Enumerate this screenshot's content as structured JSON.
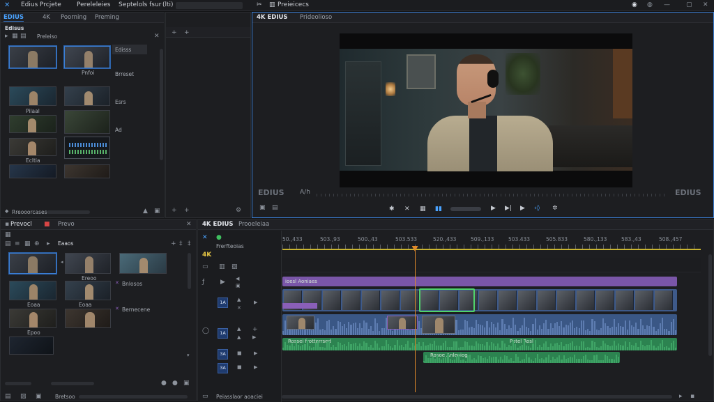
{
  "menubar": {
    "items": [
      "Edius",
      "Prcjete",
      "Pereleleies",
      "Septelols fsur",
      "(lti)"
    ],
    "preview_title": "Preieicecs"
  },
  "bin": {
    "tabs": [
      "EDIUS",
      "4K",
      "Poorning",
      "Preming"
    ],
    "folder_label": "Edisus",
    "sub_tab": "Preleiso",
    "side_labels": [
      "Edisss",
      "Brreset",
      "Esrs",
      "Ad"
    ],
    "thumb_labels": [
      "Pilaal",
      "Pnfoi",
      "Ecltia"
    ],
    "footer_label": "Rreooorcases"
  },
  "source_browser": {
    "tabs": [
      "Prevocl",
      "Prevo"
    ],
    "folder": "Eaaos",
    "labels": [
      "Ereoo",
      "Bnlosos",
      "Eoaa",
      "Bernecene",
      "Epoo"
    ],
    "footer_label": "Bretsoo"
  },
  "preview": {
    "logo": "4K EDIUS",
    "tab": "Prideolioso",
    "overlay_left": "EDIUS",
    "overlay_mid": "A/h",
    "overlay_right": "EDIUS"
  },
  "timeline": {
    "logo": "4K EDIUS",
    "tab": "Prooeleiaa",
    "sub_label": "Frerfteoias",
    "res_label": "4K",
    "ruler": [
      "50.,433",
      "503.,93",
      "500.,43",
      "503.533",
      "520.,433",
      "509.,133",
      "503.433",
      "505.833",
      "580.,133",
      "583.,43",
      "508.,457"
    ],
    "playhead_fraction": 0.316,
    "tracks": [
      "1A",
      "1A",
      "3A",
      "3A"
    ],
    "clip_names": [
      "ioesl Aoniaes",
      "Rossei frotterrsed",
      "Potel Rosl",
      "Rosoe Anleoiog"
    ],
    "footer_label": "Peiasslaor aoaciei"
  },
  "colors": {
    "accent": "#3b7fd6",
    "title_bar": "#8a5fb8",
    "video_track": "#3e5a8a",
    "audio_track": "#2f8a55",
    "playhead": "#e0892a",
    "ruler_line": "#c9b531",
    "sel_clip": "#4fd36c"
  }
}
